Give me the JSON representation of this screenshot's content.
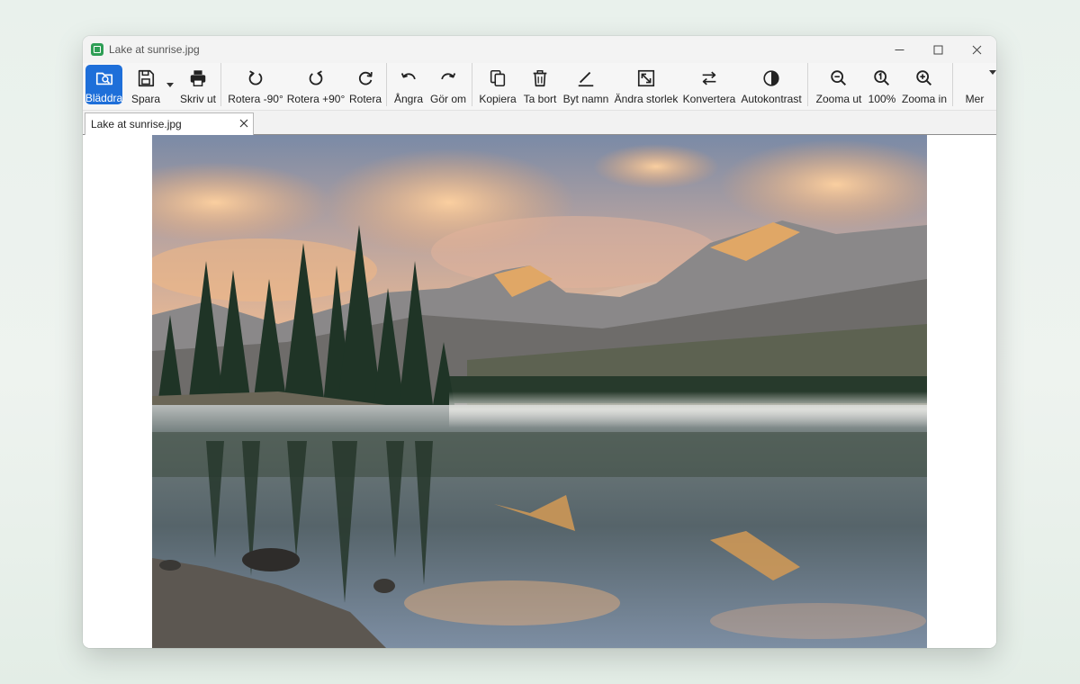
{
  "window": {
    "title": "Lake at sunrise.jpg"
  },
  "toolbar": {
    "browse": "Bläddra",
    "save": "Spara",
    "print": "Skriv ut",
    "rotate_left": "Rotera -90°",
    "rotate_right": "Rotera +90°",
    "rotate": "Rotera",
    "undo": "Ångra",
    "redo": "Gör om",
    "copy": "Kopiera",
    "delete": "Ta bort",
    "rename": "Byt namn",
    "resize": "Ändra storlek",
    "convert": "Konvertera",
    "autocontrast": "Autokontrast",
    "zoom_out": "Zooma ut",
    "zoom_level": "100%",
    "zoom_in": "Zooma in",
    "more": "Mer"
  },
  "tabs": [
    {
      "label": "Lake at sunrise.jpg"
    }
  ],
  "image": {
    "subject": "mountain lake at sunrise with pine trees and reflections",
    "colors": {
      "sky_top": "#7d8ea8",
      "cloud": "#f4b27c",
      "mountain": "#7f7f82",
      "water": "#5f6e70",
      "trees": "#1f3326"
    }
  },
  "colors": {
    "accent": "#1e6fd9",
    "toolbar_bg": "#f6f6f6",
    "app_icon": "#2e9e55"
  }
}
